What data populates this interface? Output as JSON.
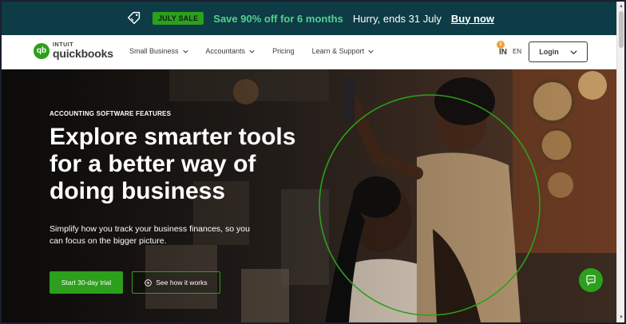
{
  "promo": {
    "icon": "price-tag-icon",
    "badge": "JULY SALE",
    "headline": "Save 90% off for 6 months",
    "urgency": "Hurry, ends 31 July",
    "cta": "Buy now",
    "colors": {
      "background": "#0d3b46",
      "accent": "#54d08e",
      "badge": "#2ca01c"
    }
  },
  "nav": {
    "logo": {
      "brand_top": "INTUIT",
      "brand_bottom": "quickbooks",
      "mark": "qb"
    },
    "menu": [
      {
        "label": "Small Business",
        "has_dropdown": true
      },
      {
        "label": "Accountants",
        "has_dropdown": true
      },
      {
        "label": "Pricing",
        "has_dropdown": false
      },
      {
        "label": "Learn & Support",
        "has_dropdown": true
      }
    ],
    "country": {
      "code": "IN",
      "badge": "1"
    },
    "language": "EN",
    "login": "Login"
  },
  "hero": {
    "eyebrow": "ACCOUNTING SOFTWARE FEATURES",
    "title_lines": [
      "Explore smarter tools",
      "for a better way of",
      "doing business"
    ],
    "subtitle": "Simplify how you track your business finances, so you can focus on the bigger picture.",
    "primary_cta": "Start 30-day trial",
    "secondary_cta": "See how it works",
    "colors": {
      "primary": "#2ca01c"
    }
  },
  "chat": {
    "icon": "chat-bubble-icon"
  }
}
